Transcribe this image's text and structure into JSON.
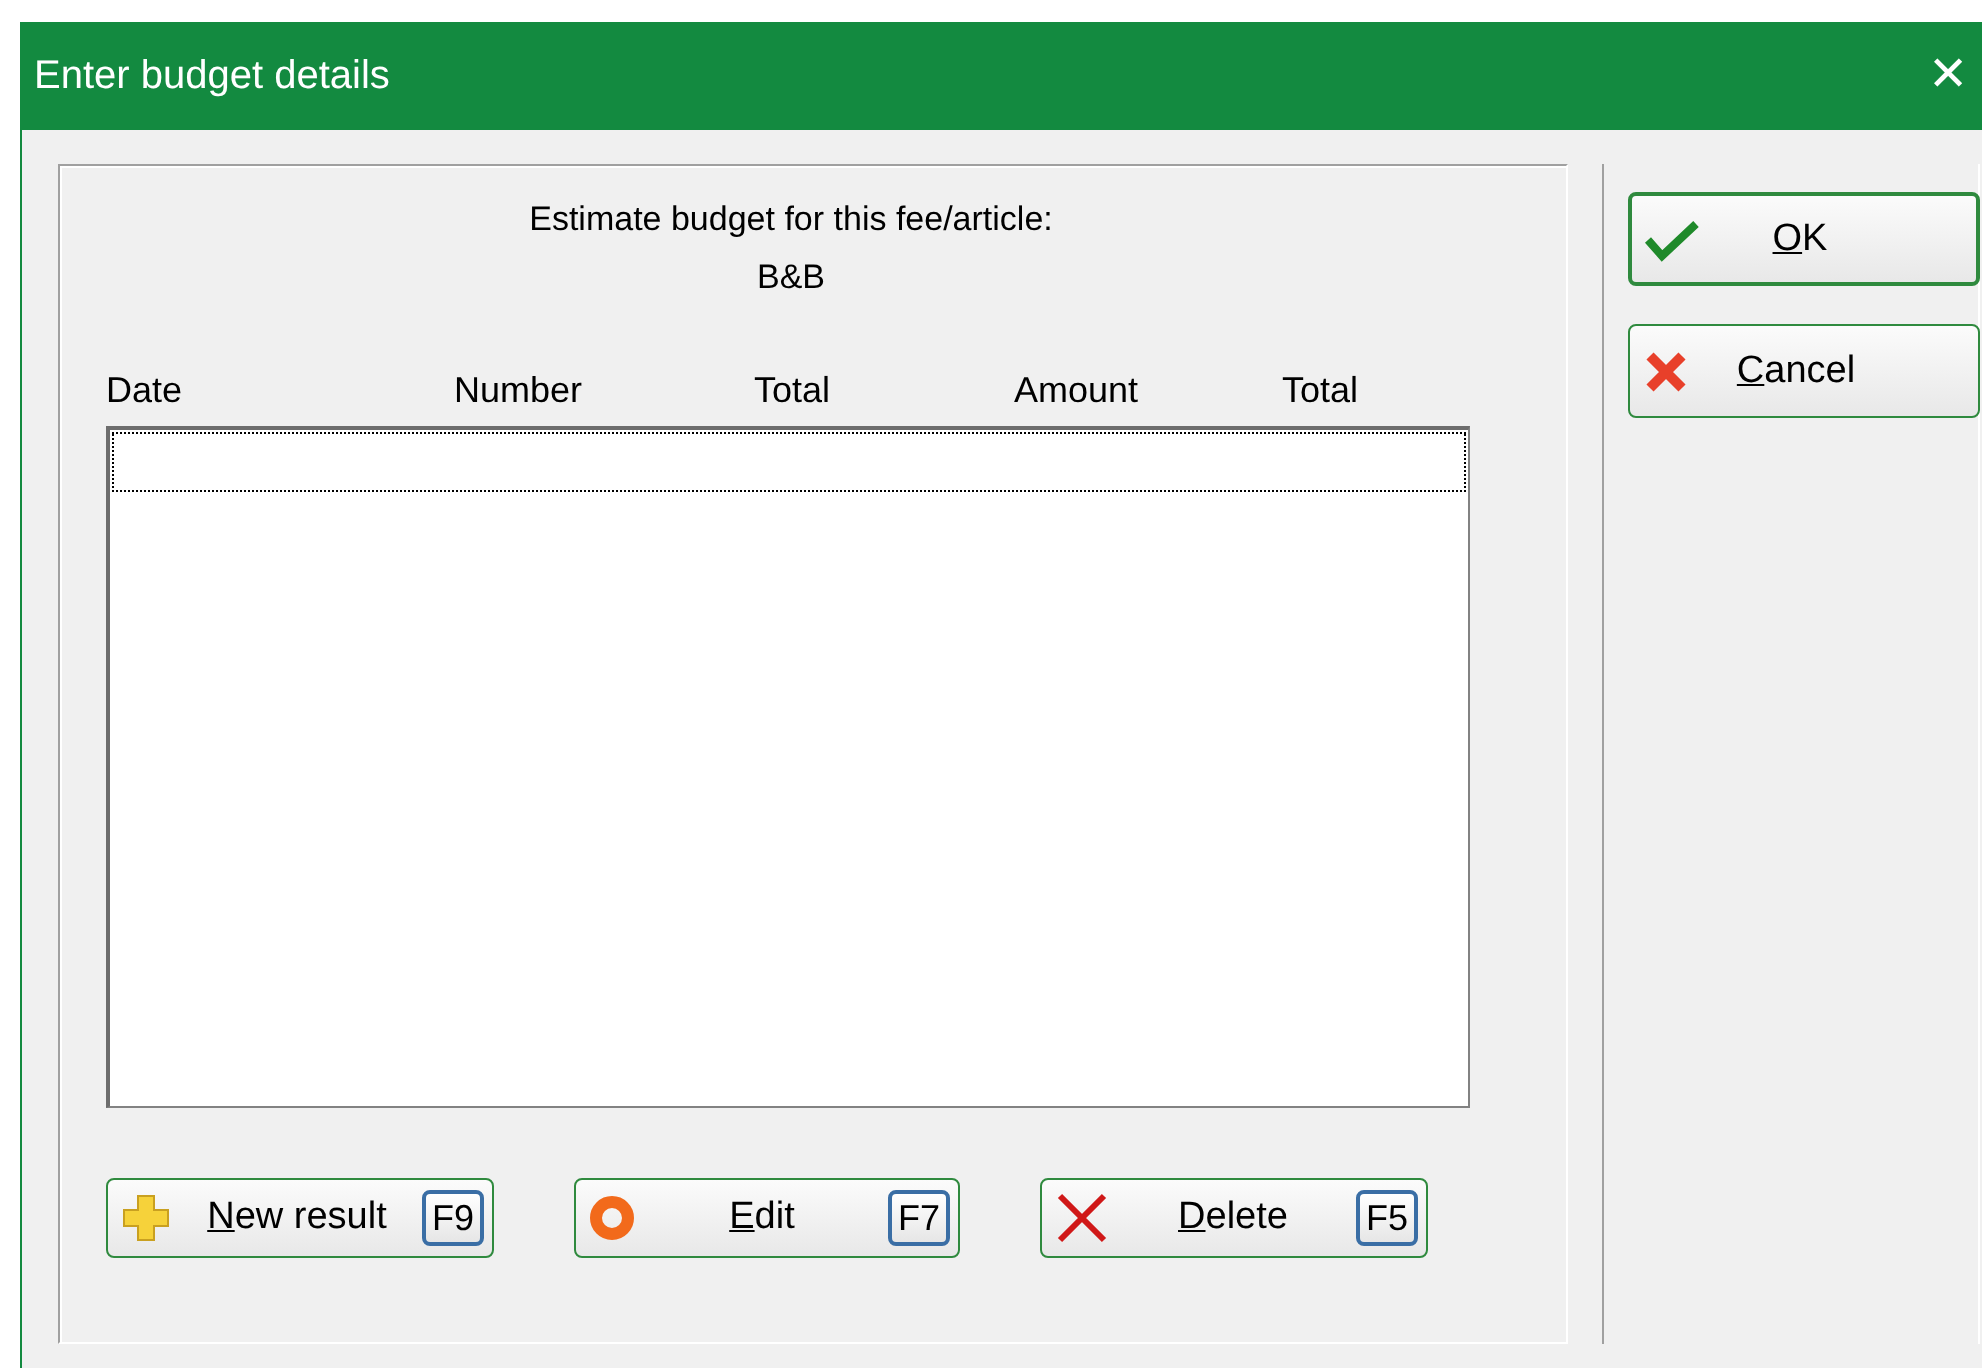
{
  "window": {
    "title": "Enter budget details",
    "close": "✕"
  },
  "heading": "Estimate budget for this fee/article:",
  "article": "B&B",
  "table": {
    "columns": [
      "Date",
      "Number",
      "Total",
      "Amount",
      "Total"
    ],
    "rows": [
      {
        "selected": true
      }
    ]
  },
  "actions": [
    {
      "kind": "add",
      "accel": "N",
      "label_rest": "ew result",
      "shortcut": "F9"
    },
    {
      "kind": "edit",
      "accel": "E",
      "label_rest": "dit",
      "shortcut": "F7"
    },
    {
      "kind": "delete",
      "accel": "D",
      "label_rest": "elete",
      "shortcut": "F5"
    }
  ],
  "buttons": [
    {
      "kind": "ok",
      "accel": "O",
      "label_rest": "K",
      "focused": true
    },
    {
      "kind": "cancel",
      "accel": "C",
      "label_rest": "ancel",
      "focused": false
    }
  ]
}
